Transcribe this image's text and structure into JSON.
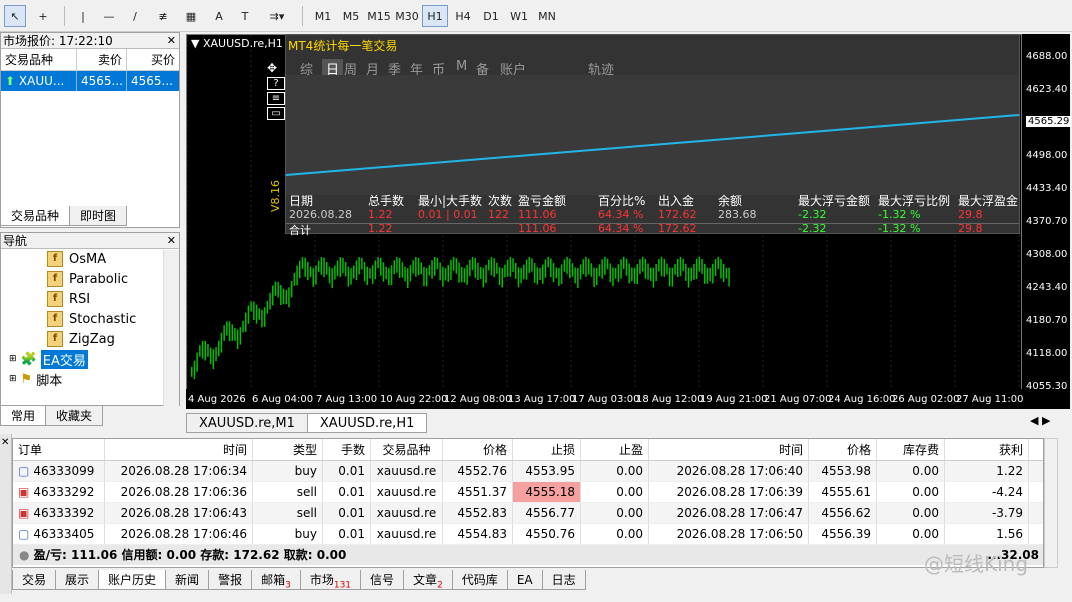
{
  "toolbar": {
    "timeframes": [
      "M1",
      "M5",
      "M15",
      "M30",
      "H1",
      "H4",
      "D1",
      "W1",
      "MN"
    ],
    "active_timeframe": "H1",
    "text_tool_label": "A"
  },
  "market_watch": {
    "title": "市场报价: 17:22:10",
    "col_symbol": "交易品种",
    "col_bid": "卖价",
    "col_ask": "买价",
    "row": {
      "symbol": "XAUU...",
      "bid": "4565...",
      "ask": "4565..."
    },
    "tab_symbols": "交易品种",
    "tab_tick": "即时图"
  },
  "navigator": {
    "title": "导航",
    "items": [
      "OsMA",
      "Parabolic",
      "RSI",
      "Stochastic",
      "ZigZag"
    ],
    "ea_label": "EA交易",
    "script_label": "脚本",
    "tab_common": "常用",
    "tab_favorites": "收藏夹"
  },
  "chart": {
    "symbol_label": "XAUUSD.re,H1",
    "overlay_title": "MT4统计每一笔交易",
    "overlay_tabs": [
      "综",
      "日",
      "周",
      "月",
      "季",
      "年",
      "币",
      "M",
      "备",
      "账户",
      "轨迹"
    ],
    "overlay_active_tab": "日",
    "version": "V8.16",
    "price_labels": [
      "4688.00",
      "4623.40",
      "4565.29",
      "4498.00",
      "4433.40",
      "4370.70",
      "4308.00",
      "4243.40",
      "4180.70",
      "4118.00",
      "4055.30"
    ],
    "current_price": "4565.29",
    "time_labels": [
      "4 Aug 2026",
      "6 Aug 04:00",
      "7 Aug 13:00",
      "10 Aug 22:00",
      "12 Aug 08:00",
      "13 Aug 17:00",
      "17 Aug 03:00",
      "18 Aug 12:00",
      "19 Aug 21:00",
      "21 Aug 07:00",
      "24 Aug 16:00",
      "26 Aug 02:00",
      "27 Aug 11:00"
    ],
    "stats_headers": [
      "日期",
      "总手数",
      "最小|大手数",
      "次数",
      "盈亏金额",
      "百分比%",
      "出入金",
      "余额",
      "最大浮亏金额",
      "最大浮亏比例",
      "最大浮盈金"
    ],
    "stats_row1": [
      "2026.08.28",
      "1.22",
      "0.01 | 0.01",
      "122",
      "111.06",
      "64.34 %",
      "172.62",
      "283.68",
      "-2.32",
      "-1.32 %",
      "29.8"
    ],
    "stats_row2": [
      "合计",
      "1.22",
      "",
      "",
      "111.06",
      "64.34 %",
      "172.62",
      "",
      "-2.32",
      "-1.32 %",
      "29.8"
    ],
    "bg_color": "#000000",
    "line_color": "#22b6e8",
    "candle_color": "#00c000"
  },
  "chart_tabs": [
    "XAUUSD.re,M1",
    "XAUUSD.re,H1"
  ],
  "chart_tab_active": "XAUUSD.re,H1",
  "terminal": {
    "headers": [
      "订单",
      "时间",
      "类型",
      "手数",
      "交易品种",
      "价格",
      "止损",
      "止盈",
      "时间",
      "价格",
      "库存费",
      "获利"
    ],
    "rows": [
      [
        "46333099",
        "2026.08.28 17:06:34",
        "buy",
        "0.01",
        "xauusd.re",
        "4552.76",
        "4553.95",
        "0.00",
        "2026.08.28 17:06:40",
        "4553.98",
        "0.00",
        "1.22"
      ],
      [
        "46333292",
        "2026.08.28 17:06:36",
        "sell",
        "0.01",
        "xauusd.re",
        "4551.37",
        "4555.18",
        "0.00",
        "2026.08.28 17:06:39",
        "4555.61",
        "0.00",
        "-4.24"
      ],
      [
        "46333392",
        "2026.08.28 17:06:43",
        "sell",
        "0.01",
        "xauusd.re",
        "4552.83",
        "4556.77",
        "0.00",
        "2026.08.28 17:06:47",
        "4556.62",
        "0.00",
        "-3.79"
      ],
      [
        "46333405",
        "2026.08.28 17:06:46",
        "buy",
        "0.01",
        "xauusd.re",
        "4554.83",
        "4550.76",
        "0.00",
        "2026.08.28 17:06:50",
        "4556.39",
        "0.00",
        "1.56"
      ]
    ],
    "summary": "盈/亏: 111.06  信用额: 0.00  存款: 172.62  取款: 0.00",
    "summary_total": "...32.08"
  },
  "bottom_tabs": [
    {
      "label": "交易",
      "badge": ""
    },
    {
      "label": "展示",
      "badge": ""
    },
    {
      "label": "账户历史",
      "badge": ""
    },
    {
      "label": "新闻",
      "badge": ""
    },
    {
      "label": "警报",
      "badge": ""
    },
    {
      "label": "邮箱",
      "badge": "3"
    },
    {
      "label": "市场",
      "badge": "131"
    },
    {
      "label": "信号",
      "badge": ""
    },
    {
      "label": "文章",
      "badge": "2"
    },
    {
      "label": "代码库",
      "badge": ""
    },
    {
      "label": "EA",
      "badge": ""
    },
    {
      "label": "日志",
      "badge": ""
    }
  ],
  "bottom_tab_active": "账户历史",
  "watermark": "@短线King"
}
